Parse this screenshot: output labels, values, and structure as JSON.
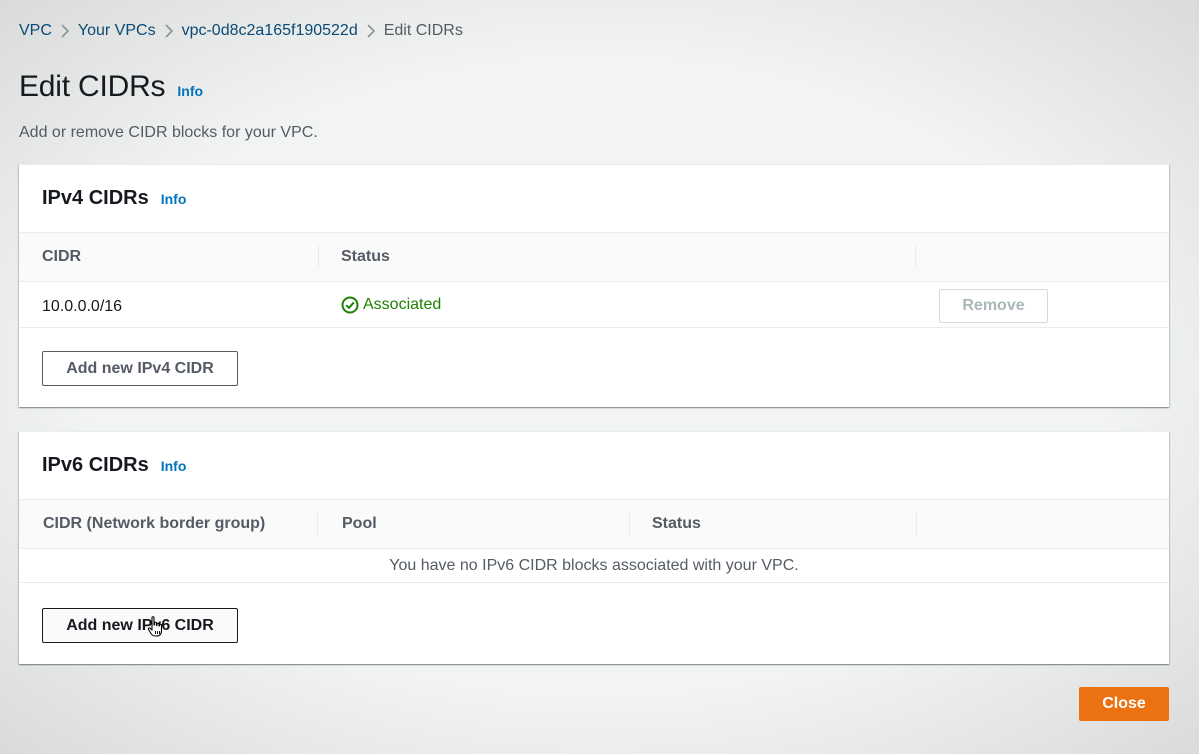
{
  "breadcrumb": {
    "items": [
      "VPC",
      "Your VPCs",
      "vpc-0d8c2a165f190522d"
    ],
    "current": "Edit CIDRs"
  },
  "page": {
    "title": "Edit CIDRs",
    "info": "Info",
    "description": "Add or remove CIDR blocks for your VPC."
  },
  "ipv4": {
    "title": "IPv4 CIDRs",
    "info": "Info",
    "columns": [
      "CIDR",
      "Status"
    ],
    "rows": [
      {
        "cidr": "10.0.0.0/16",
        "status": "Associated",
        "remove_label": "Remove"
      }
    ],
    "add_button": "Add new IPv4 CIDR"
  },
  "ipv6": {
    "title": "IPv6 CIDRs",
    "info": "Info",
    "columns": [
      "CIDR (Network border group)",
      "Pool",
      "Status"
    ],
    "empty_message": "You have no IPv6 CIDR blocks associated with your VPC.",
    "add_button": "Add new IPv6 CIDR"
  },
  "footer": {
    "close_button": "Close"
  },
  "colors": {
    "link": "#0a4a74",
    "info": "#0073bb",
    "success": "#1d8102",
    "primary": "#ec7211"
  },
  "icons": {
    "status": "check-circle-icon",
    "separator": "chevron-right-icon",
    "cursor": "hand-pointer-icon"
  }
}
